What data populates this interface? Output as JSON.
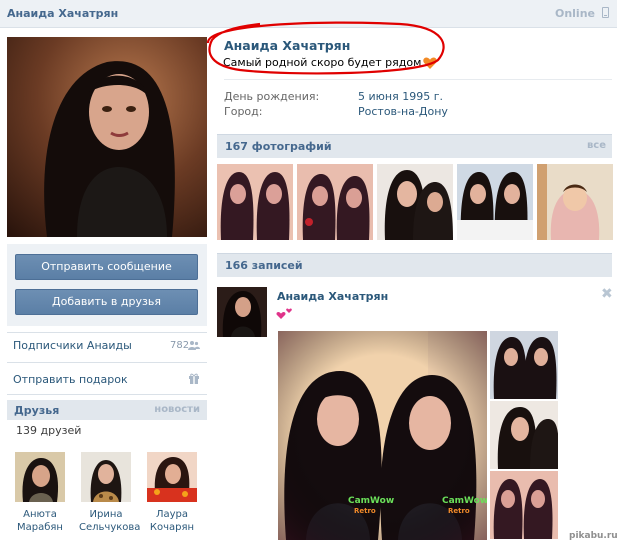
{
  "header": {
    "name": "Анаида Хачатрян",
    "online": "Online",
    "phone_icon": "mobile-icon"
  },
  "profile": {
    "name": "Анаида Хачатрян",
    "status": "Самый родной скоро будет рядом",
    "status_emoji": "heart-icon",
    "birthday_label": "День рождения:",
    "birthday_value": "5 июня 1995 г.",
    "city_label": "Город:",
    "city_value": "Ростов-на-Дону"
  },
  "left": {
    "send_message": "Отправить сообщение",
    "add_friend": "Добавить в друзья",
    "followers_label": "Подписчики Анаиды",
    "followers_count": "782",
    "gift_label": "Отправить подарок",
    "friends_title": "Друзья",
    "friends_news": "новости",
    "friends_count": "139 друзей",
    "friends": [
      {
        "first": "Анюта",
        "last": "Марабян"
      },
      {
        "first": "Ирина",
        "last": "Сельчукова"
      },
      {
        "first": "Лаура",
        "last": "Кочарян"
      }
    ]
  },
  "photos": {
    "title": "167 фотографий",
    "all": "все"
  },
  "wall": {
    "title": "166 записей",
    "post_author": "Анаида Хачатрян",
    "close": "✖",
    "watermark_big": "CamWow Retro"
  },
  "footer": {
    "watermark": "pikabu.ru"
  },
  "colors": {
    "accent": "#45688e",
    "link": "#2b587a",
    "header_bg": "#edf1f5",
    "section_bg": "#e1e7ed",
    "button": "#5b7fa6",
    "annotation_red": "#e00000"
  }
}
